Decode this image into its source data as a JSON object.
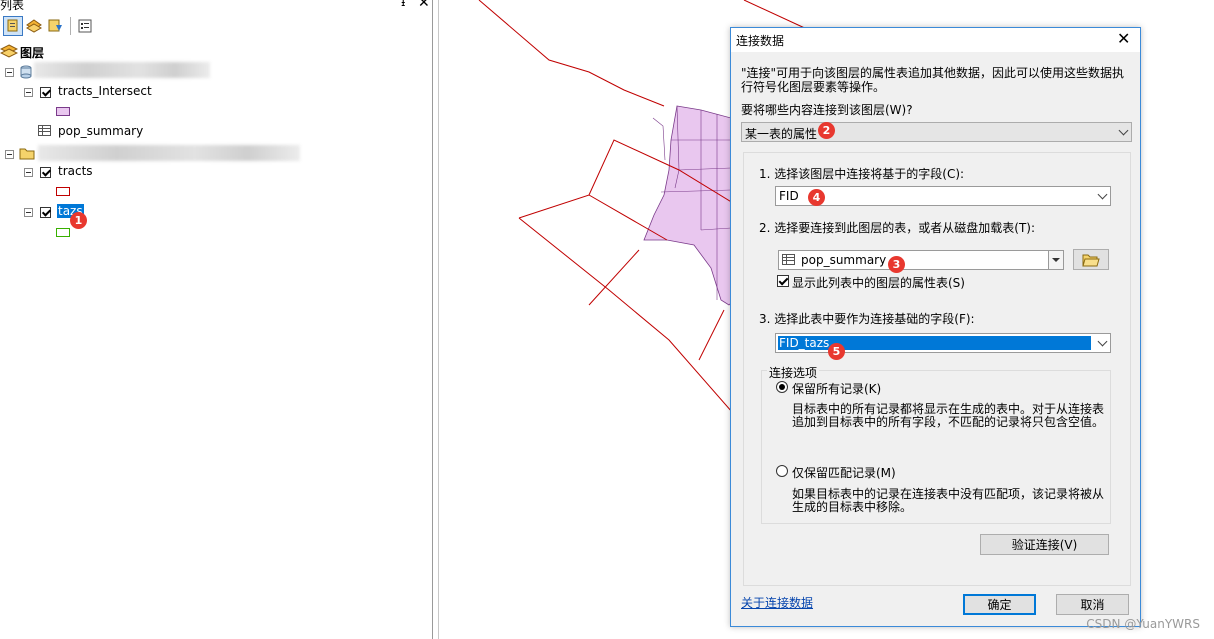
{
  "toc": {
    "title": "列表",
    "pin_glyph": "ᵻ",
    "close_glyph": "✕",
    "root_label": "图层",
    "layers": [
      {
        "label": "tracts_Intersect",
        "checked": true
      },
      {
        "label": "pop_summary"
      },
      {
        "label": "tracts",
        "checked": true
      },
      {
        "label": "tazs",
        "checked": true,
        "selected": true
      }
    ]
  },
  "badges": [
    "1",
    "2",
    "3",
    "4",
    "5"
  ],
  "dialog": {
    "title": "连接数据",
    "close_glyph": "✕",
    "intro_line1": "\"连接\"可用于向该图层的属性表追加其他数据，因此可以使用这些数据执",
    "intro_line2": "行符号化图层要素等操作。",
    "question": "要将哪些内容连接到该图层(W)?",
    "join_type": "某一表的属性",
    "step1_label": "1. 选择该图层中连接将基于的字段(C):",
    "step1_value": "FID",
    "step2_label": "2. 选择要连接到此图层的表，或者从磁盘加载表(T):",
    "step2_value": "pop_summary",
    "show_attr_tables": "显示此列表中的图层的属性表(S)",
    "step3_label": "3. 选择此表中要作为连接基础的字段(F):",
    "step3_value": "FID_tazs",
    "options_title": "连接选项",
    "keep_all_label": "保留所有记录(K)",
    "keep_all_desc1": "目标表中的所有记录都将显示在生成的表中。对于从连接表",
    "keep_all_desc2": "追加到目标表中的所有字段，不匹配的记录将只包含空值。",
    "keep_matching_label": "仅保留匹配记录(M)",
    "keep_matching_desc1": "如果目标表中的记录在连接表中没有匹配项，该记录将被从",
    "keep_matching_desc2": "生成的目标表中移除。",
    "validate_button": "验证连接(V)",
    "about_link": "关于连接数据",
    "ok_button": "确定",
    "cancel_button": "取消"
  },
  "watermark": "CSDN @YuanYWRS",
  "colors": {
    "accent": "#0078d7",
    "badge": "#e8382f",
    "polygon_fill": "#e9c7ef",
    "tract_outline": "#c00000",
    "tazs_symbol": "#38b000",
    "link": "#0645ad"
  }
}
